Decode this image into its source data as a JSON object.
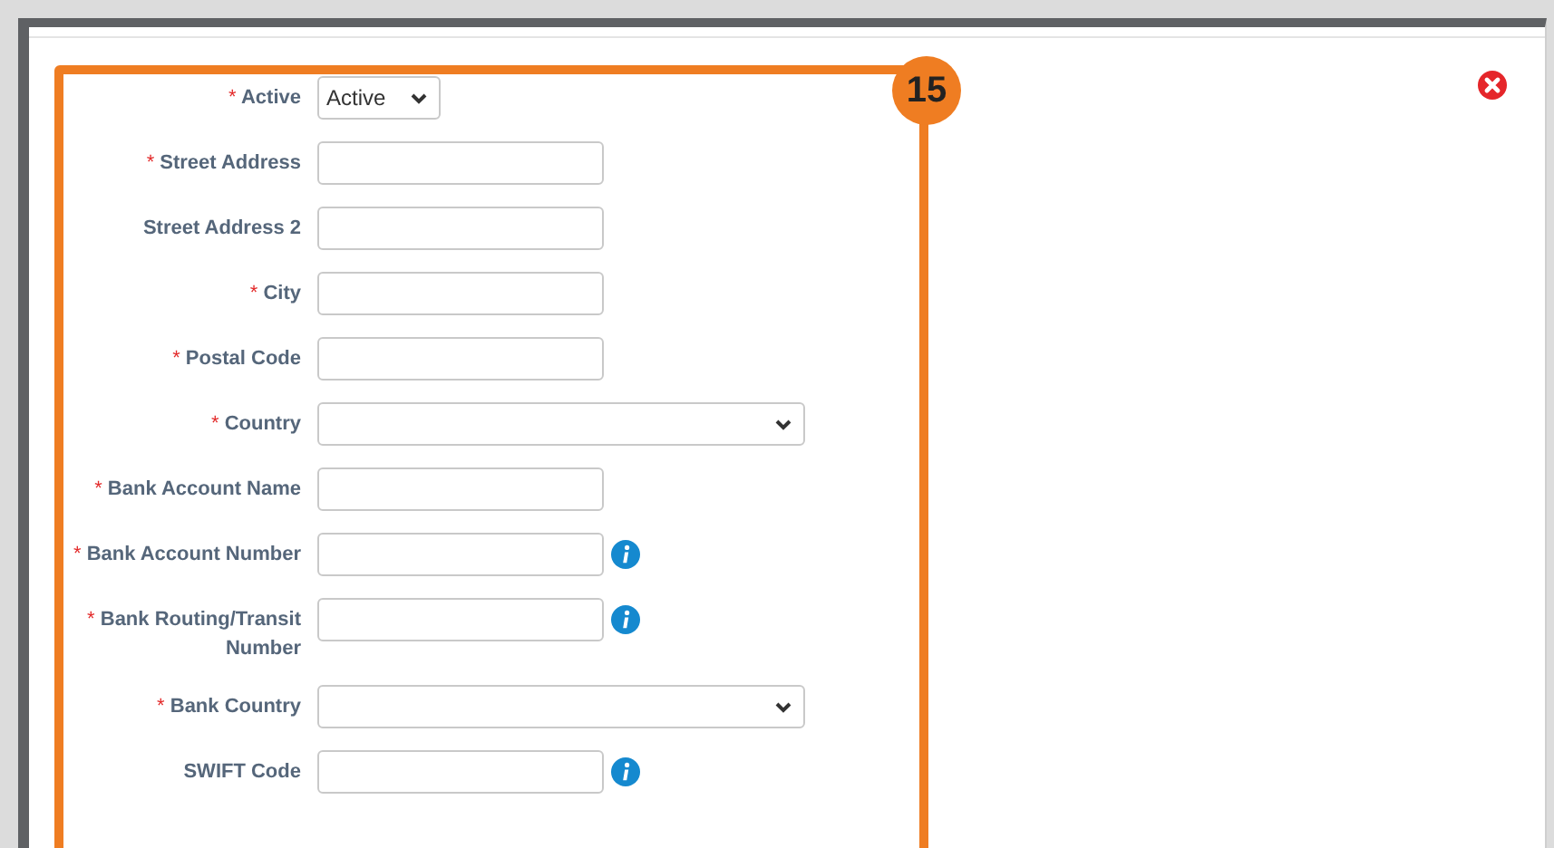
{
  "badge": "15",
  "fields": [
    {
      "kind": "short-select",
      "required_mark": "*",
      "label": "Active",
      "value": "Active",
      "info": false
    },
    {
      "kind": "text",
      "required_mark": "*",
      "label": "Street Address",
      "info": false
    },
    {
      "kind": "text",
      "label": "Street Address 2",
      "info": false
    },
    {
      "kind": "text",
      "required_mark": "*",
      "label": "City",
      "info": false
    },
    {
      "kind": "text",
      "required_mark": "*",
      "label": "Postal Code",
      "info": false
    },
    {
      "kind": "select",
      "required_mark": "*",
      "label": "Country",
      "info": false
    },
    {
      "kind": "text",
      "required_mark": "*",
      "label": "Bank Account Name",
      "info": false
    },
    {
      "kind": "text",
      "required_mark": "*",
      "label": "Bank Account Number",
      "info": true
    },
    {
      "kind": "text",
      "required_mark": "*",
      "label": "Bank Routing/Transit Number",
      "info": true
    },
    {
      "kind": "select",
      "required_mark": "*",
      "label": "Bank Country",
      "info": false
    },
    {
      "kind": "text",
      "label": "SWIFT Code",
      "info": true
    }
  ]
}
